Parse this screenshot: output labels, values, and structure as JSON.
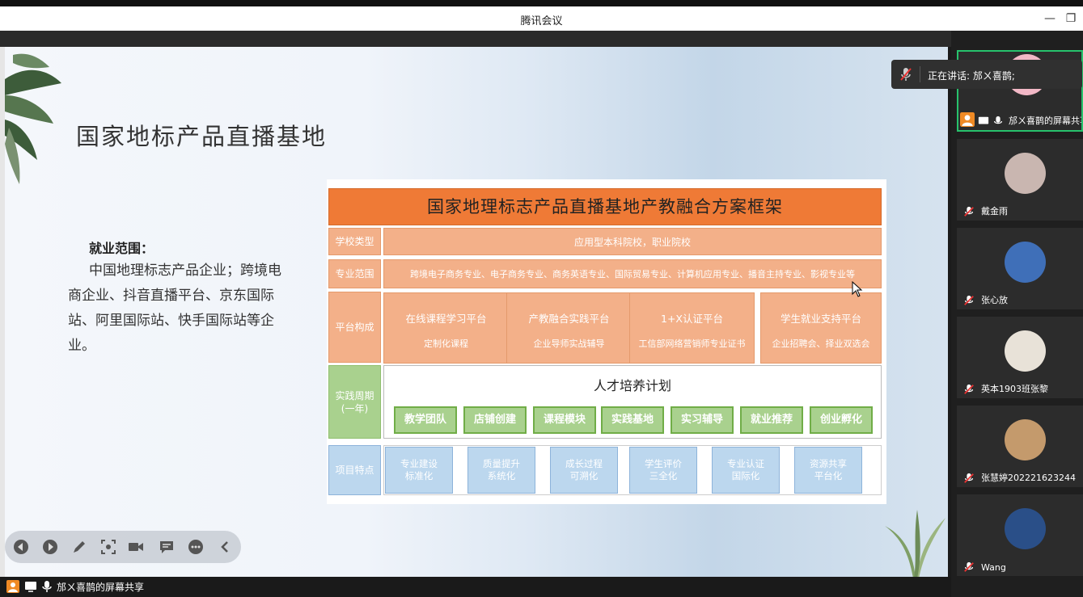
{
  "window": {
    "title": "腾讯会议"
  },
  "slide": {
    "title": "国家地标产品直播基地",
    "employment_heading": "就业范围：",
    "employment_body": "中国地理标志产品企业；跨境电商企业、抖音直播平台、京东国际站、阿里国际站、快手国际站等企业。"
  },
  "framework": {
    "title": "国家地理标志产品直播基地产教融合方案框架",
    "rows": {
      "school_type": {
        "label": "学校类型",
        "value": "应用型本科院校，职业院校"
      },
      "major_scope": {
        "label": "专业范围",
        "value": "跨境电子商务专业、电子商务专业、商务英语专业、国际贸易专业、计算机应用专业、播音主持专业、影视专业等"
      },
      "platform": {
        "label": "平台构成",
        "items": [
          {
            "title": "在线课程学习平台",
            "sub": "定制化课程"
          },
          {
            "title": "产教融合实践平台",
            "sub": "企业导师实战辅导"
          },
          {
            "title": "1+X认证平台",
            "sub": "工信部网络营销师专业证书"
          },
          {
            "title": "学生就业支持平台",
            "sub": "企业招聘会、择业双选会"
          }
        ]
      },
      "practice": {
        "label": "实践周期\n(一年)",
        "plan_title": "人才培养计划",
        "items": [
          "教学团队",
          "店铺创建",
          "课程模块",
          "实践基地",
          "实习辅导",
          "就业推荐",
          "创业孵化"
        ]
      },
      "features": {
        "label": "项目特点",
        "items": [
          [
            "专业建设",
            "标准化"
          ],
          [
            "质量提升",
            "系统化"
          ],
          [
            "成长过程",
            "可溯化"
          ],
          [
            "学生评价",
            "三全化"
          ],
          [
            "专业认证",
            "国际化"
          ],
          [
            "资源共享",
            "平台化"
          ]
        ]
      }
    }
  },
  "speaking": {
    "text": "正在讲话: 邡ㄨ喜鹊;"
  },
  "share_label": "邡ㄨ喜鹊的屏幕共享",
  "participants": [
    {
      "name": "邡ㄨ喜鹊的屏幕共享",
      "avatar_color": "#f2b8c6",
      "active": true
    },
    {
      "name": "戴金雨",
      "avatar_color": "#c9b6b0",
      "active": false
    },
    {
      "name": "张心放",
      "avatar_color": "#3f6fb8",
      "active": false
    },
    {
      "name": "英本1903班张黎",
      "avatar_color": "#e8e2d8",
      "active": false
    },
    {
      "name": "张慧婷202221623244",
      "avatar_color": "#c49a6c",
      "active": false
    },
    {
      "name": "Wang",
      "avatar_color": "#2a4f88",
      "active": false
    }
  ],
  "colors": {
    "header_orange": "#ef7a36",
    "cell_orange": "#f3b089",
    "green": "#a9d18e",
    "green_border": "#70ad47",
    "blue": "#bcd7ee",
    "active_green": "#27c26c"
  }
}
